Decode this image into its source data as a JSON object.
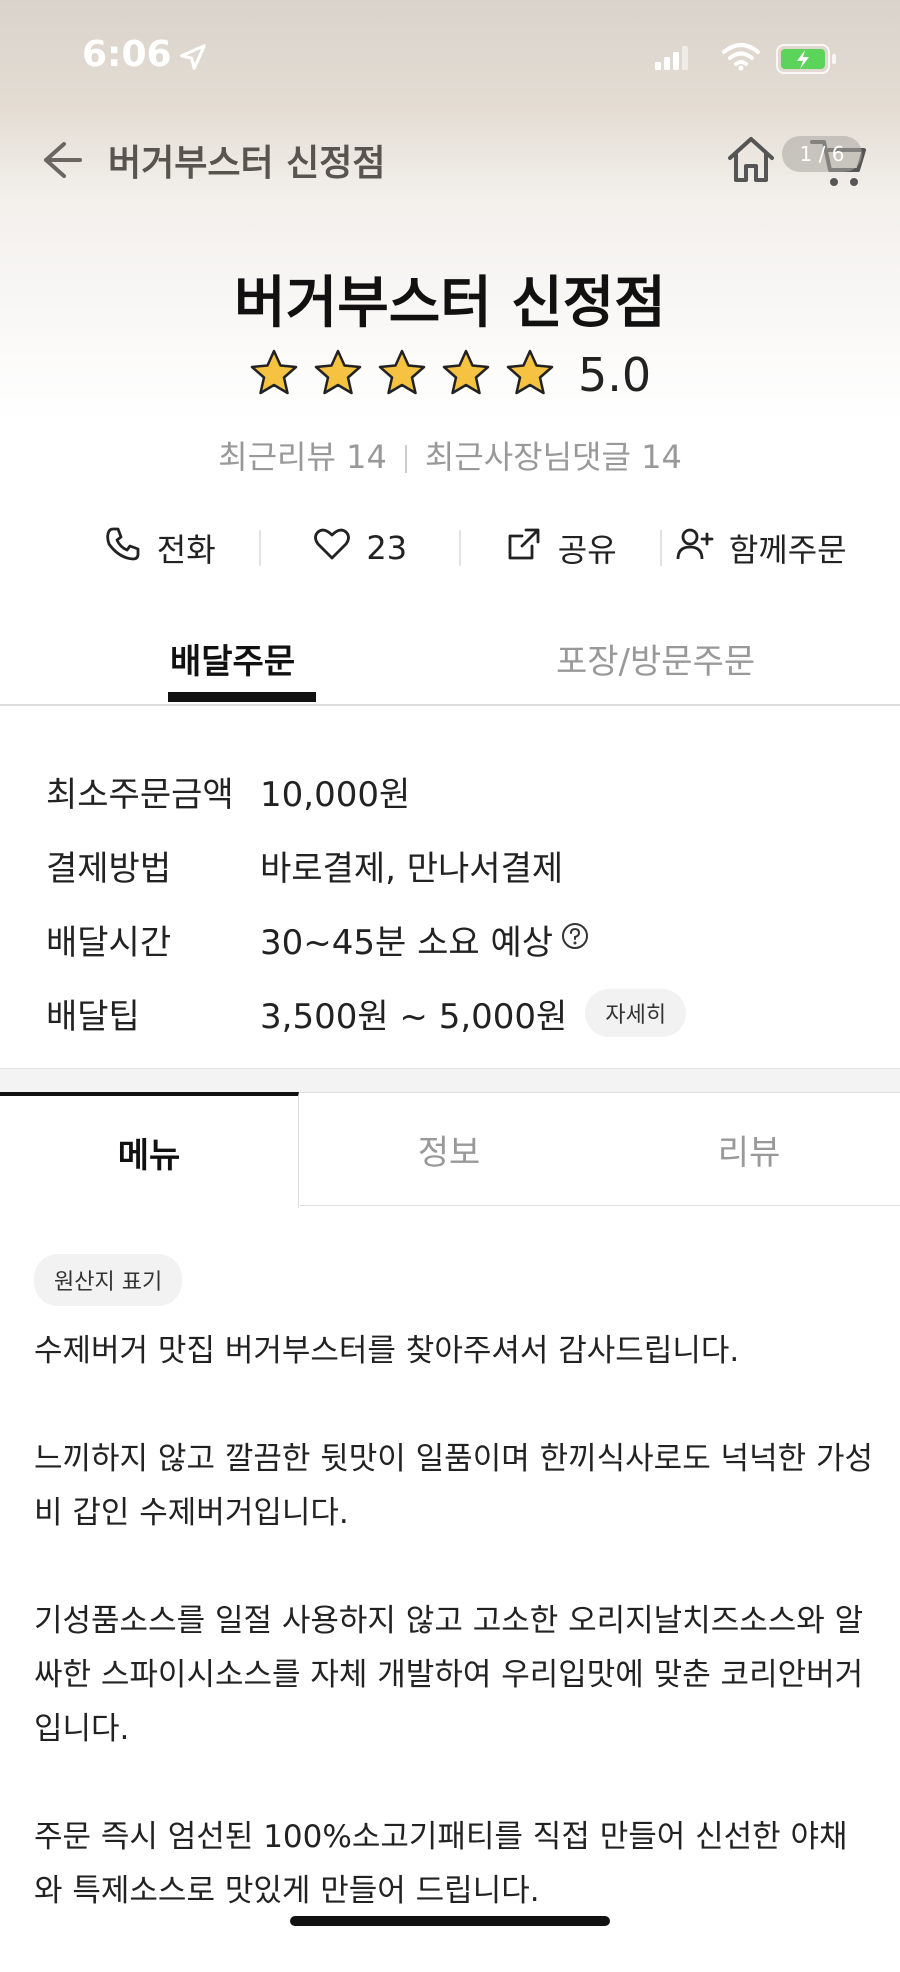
{
  "status_bar": {
    "time": "6:06"
  },
  "nav": {
    "title": "버거부스터 신정점",
    "cart_badge": "1 / 6"
  },
  "store": {
    "name": "버거부스터 신정점",
    "rating": "5.0",
    "stars": 5,
    "recent_reviews": "최근리뷰 14",
    "recent_owner_replies": "최근사장님댓글 14"
  },
  "actions": {
    "call": "전화",
    "like_count": "23",
    "share": "공유",
    "group_order": "함께주문"
  },
  "order_tabs": {
    "delivery": "배달주문",
    "pickup": "포장/방문주문"
  },
  "info": {
    "min_order_label": "최소주문금액",
    "min_order_value": "10,000원",
    "payment_label": "결제방법",
    "payment_value": "바로결제, 만나서결제",
    "delivery_time_label": "배달시간",
    "delivery_time_value": "30~45분 소요 예상",
    "delivery_tip_label": "배달팁",
    "delivery_tip_value": "3,500원 ~ 5,000원",
    "detail_button": "자세히"
  },
  "content_tabs": {
    "menu": "메뉴",
    "info": "정보",
    "review": "리뷰"
  },
  "origin_label": "원산지 표기",
  "intro": {
    "p1": "수제버거 맛집 버거부스터를 찾아주셔서 감사드립니다.",
    "p2": "느끼하지 않고 깔끔한 뒷맛이 일품이며 한끼식사로도 넉넉한 가성비 갑인 수제버거입니다.",
    "p3": "기성품소스를 일절 사용하지 않고 고소한  오리지날치즈소스와 알싸한 스파이시소스를 자체 개발하여 우리입맛에 맞춘 코리안버거입니다.",
    "p4": "주문 즉시 엄선된 100%소고기패티를 직접 만들어 신선한 야채와 특제소스로 맛있게 만들어 드립니다."
  },
  "colors": {
    "accent": "#111111",
    "star": "#f5c242",
    "muted": "#999999"
  }
}
